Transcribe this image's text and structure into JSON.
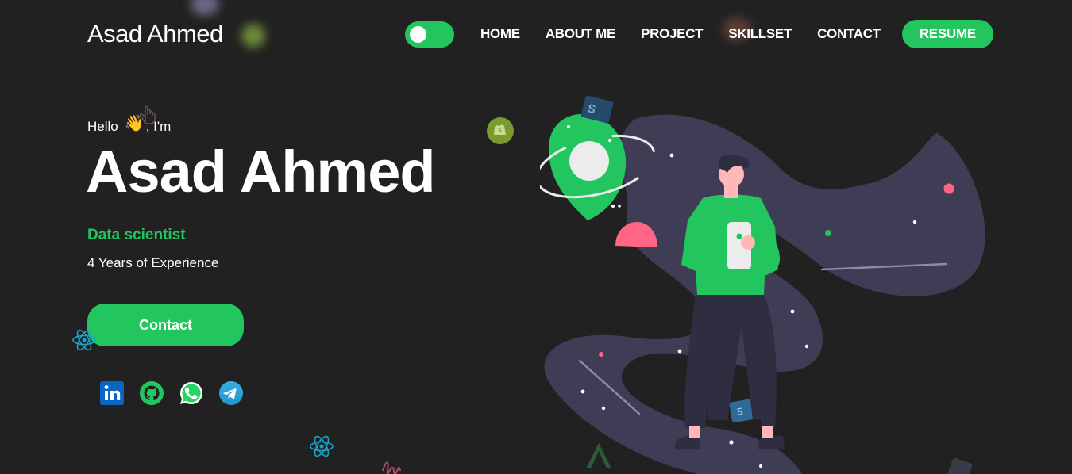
{
  "header": {
    "brand": "Asad Ahmed",
    "theme_toggle": "on",
    "nav": [
      {
        "label": "HOME"
      },
      {
        "label": "ABOUT ME"
      },
      {
        "label": "PROJECT"
      },
      {
        "label": "SKILLSET"
      },
      {
        "label": "CONTACT"
      }
    ],
    "resume_label": "RESUME"
  },
  "hero": {
    "greeting_before": "Hello",
    "greeting_emoji": "👋",
    "greeting_after": ", I'm",
    "name": "Asad Ahmed",
    "role": "Data scientist",
    "experience": "4 Years of Experience",
    "contact_label": "Contact"
  },
  "socials": [
    {
      "icon": "linkedin-icon"
    },
    {
      "icon": "github-icon"
    },
    {
      "icon": "whatsapp-icon"
    },
    {
      "icon": "telegram-icon"
    }
  ],
  "colors": {
    "background": "#212121",
    "accent": "#22c55e",
    "text": "#ffffff"
  }
}
